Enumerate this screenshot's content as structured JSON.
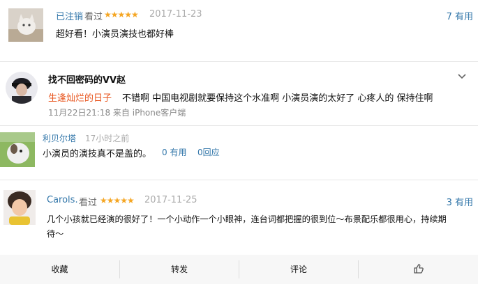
{
  "reviews": [
    {
      "user": "已注销",
      "seen": "看过",
      "stars": "★★★★★",
      "date": "2017-11-23",
      "useful": "7 有用",
      "text": "超好看！小演员演技也都好棒"
    },
    {
      "user": "Carols.",
      "seen": "看过",
      "stars": "★★★★★",
      "date": "2017-11-25",
      "useful": "3 有用",
      "text_line1": "几个小孩就已经演的很好了！一个小动作一个小眼神，连台词都把握的很到位～布景配乐都很用心，持续期",
      "text_line2": "待～"
    }
  ],
  "weibo": {
    "user": "找不回密码的VV赵",
    "tag": "生逢灿烂的日子",
    "text": "不错啊 中国电视剧就要保持这个水准啊 小演员演的太好了 心疼人的 保持住啊",
    "meta": "11月22日21:18 来自 iPhone客户端"
  },
  "comment": {
    "user": "利贝尔塔",
    "time": "17小时之前",
    "text": "小演员的演技真不是盖的。",
    "useful": "0 有用",
    "reply": "0回应"
  },
  "bottom_bar": {
    "collect": "收藏",
    "share": "转发",
    "comment": "评论"
  },
  "icons": {
    "expand": "chevron-down-icon",
    "like": "thumbs-up-icon"
  },
  "colors": {
    "link": "#3377aa",
    "star": "#f5a623",
    "tag": "#e8551e"
  }
}
